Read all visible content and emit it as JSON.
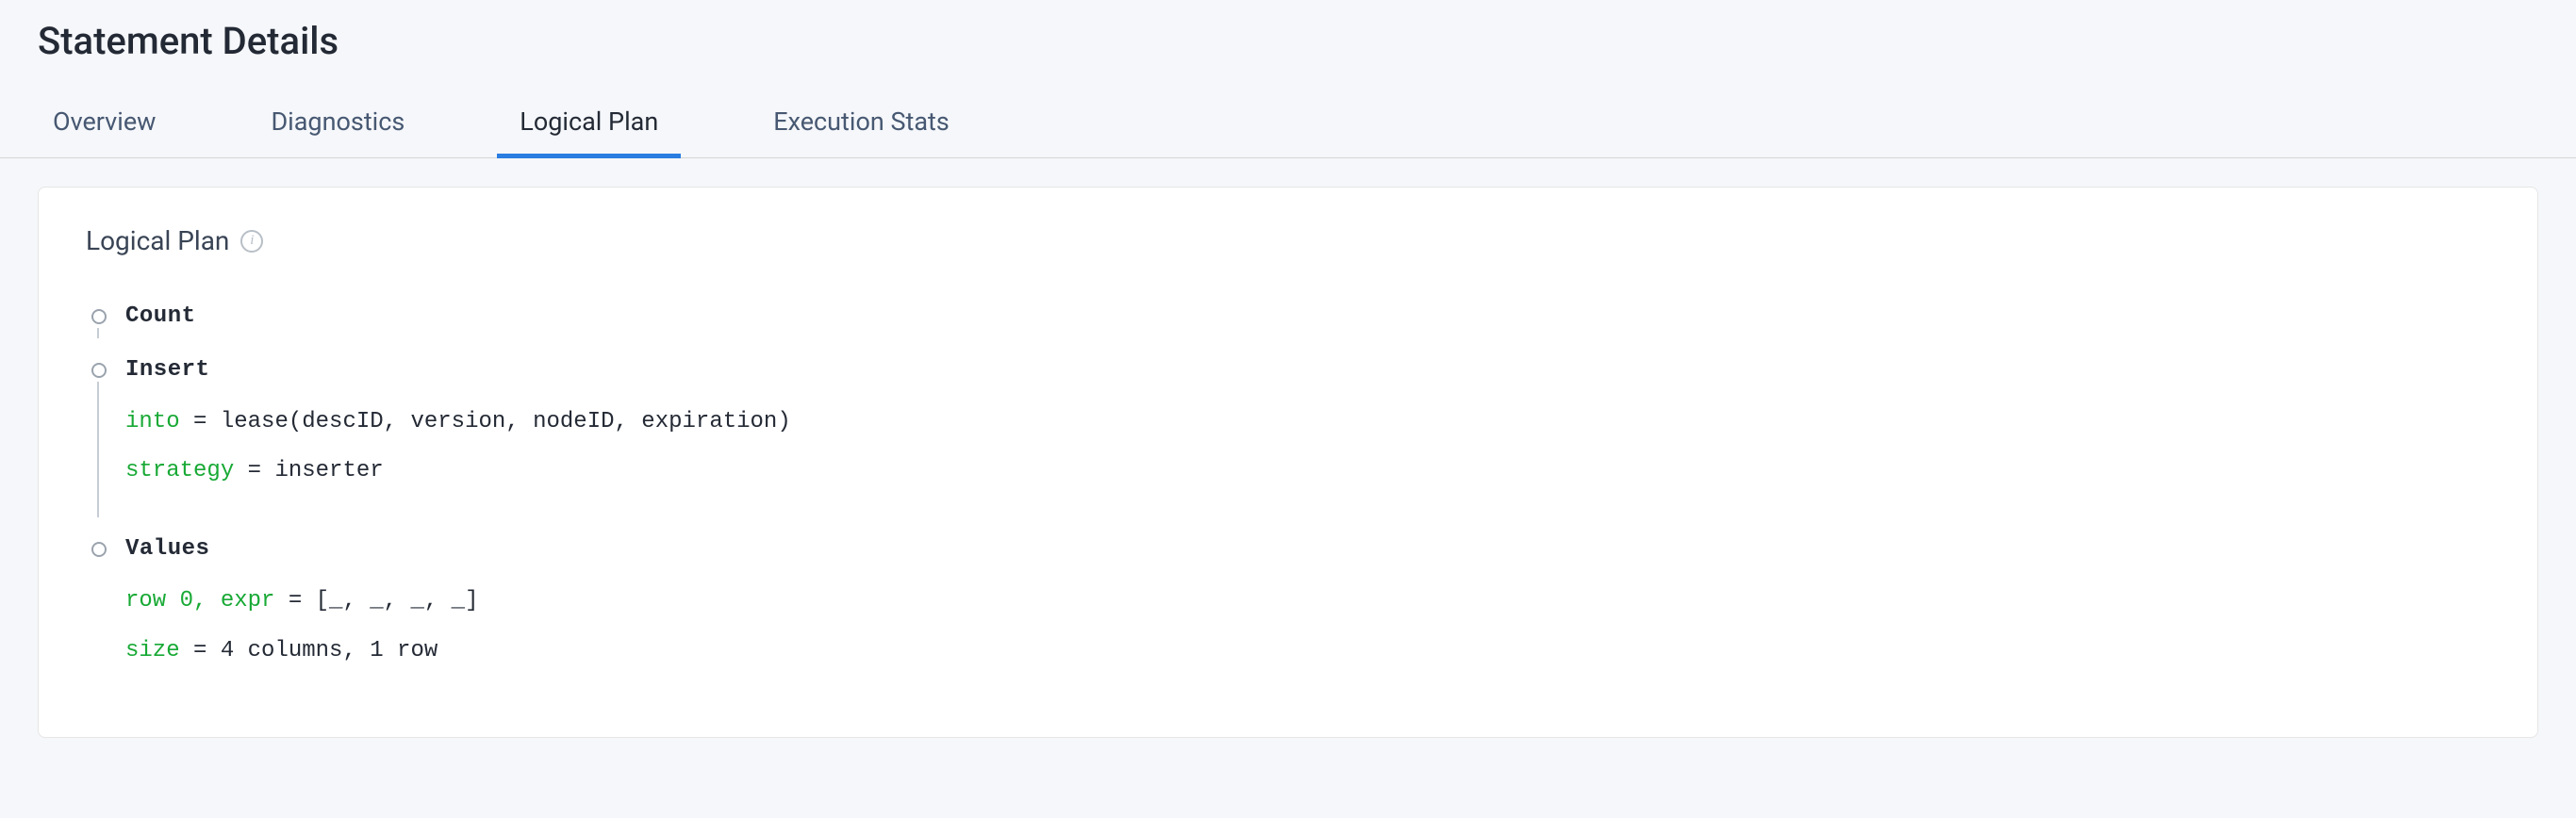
{
  "header": {
    "title": "Statement Details"
  },
  "tabs": {
    "items": [
      {
        "label": "Overview",
        "active": false
      },
      {
        "label": "Diagnostics",
        "active": false
      },
      {
        "label": "Logical Plan",
        "active": true
      },
      {
        "label": "Execution Stats",
        "active": false
      }
    ]
  },
  "panel": {
    "title": "Logical Plan",
    "info_glyph": "i"
  },
  "plan": {
    "nodes": [
      {
        "title": "Count",
        "details": []
      },
      {
        "title": "Insert",
        "details": [
          {
            "key": "into",
            "eq": " = ",
            "value": "lease(descID, version, nodeID, expiration)"
          },
          {
            "key": "strategy",
            "eq": " = ",
            "value": "inserter"
          }
        ]
      },
      {
        "title": "Values",
        "details": [
          {
            "key": "row 0, expr",
            "eq": " = ",
            "value": "[_, _, _, _]"
          },
          {
            "key": "size",
            "eq": " = ",
            "value": "4 columns, 1 row"
          }
        ]
      }
    ]
  }
}
